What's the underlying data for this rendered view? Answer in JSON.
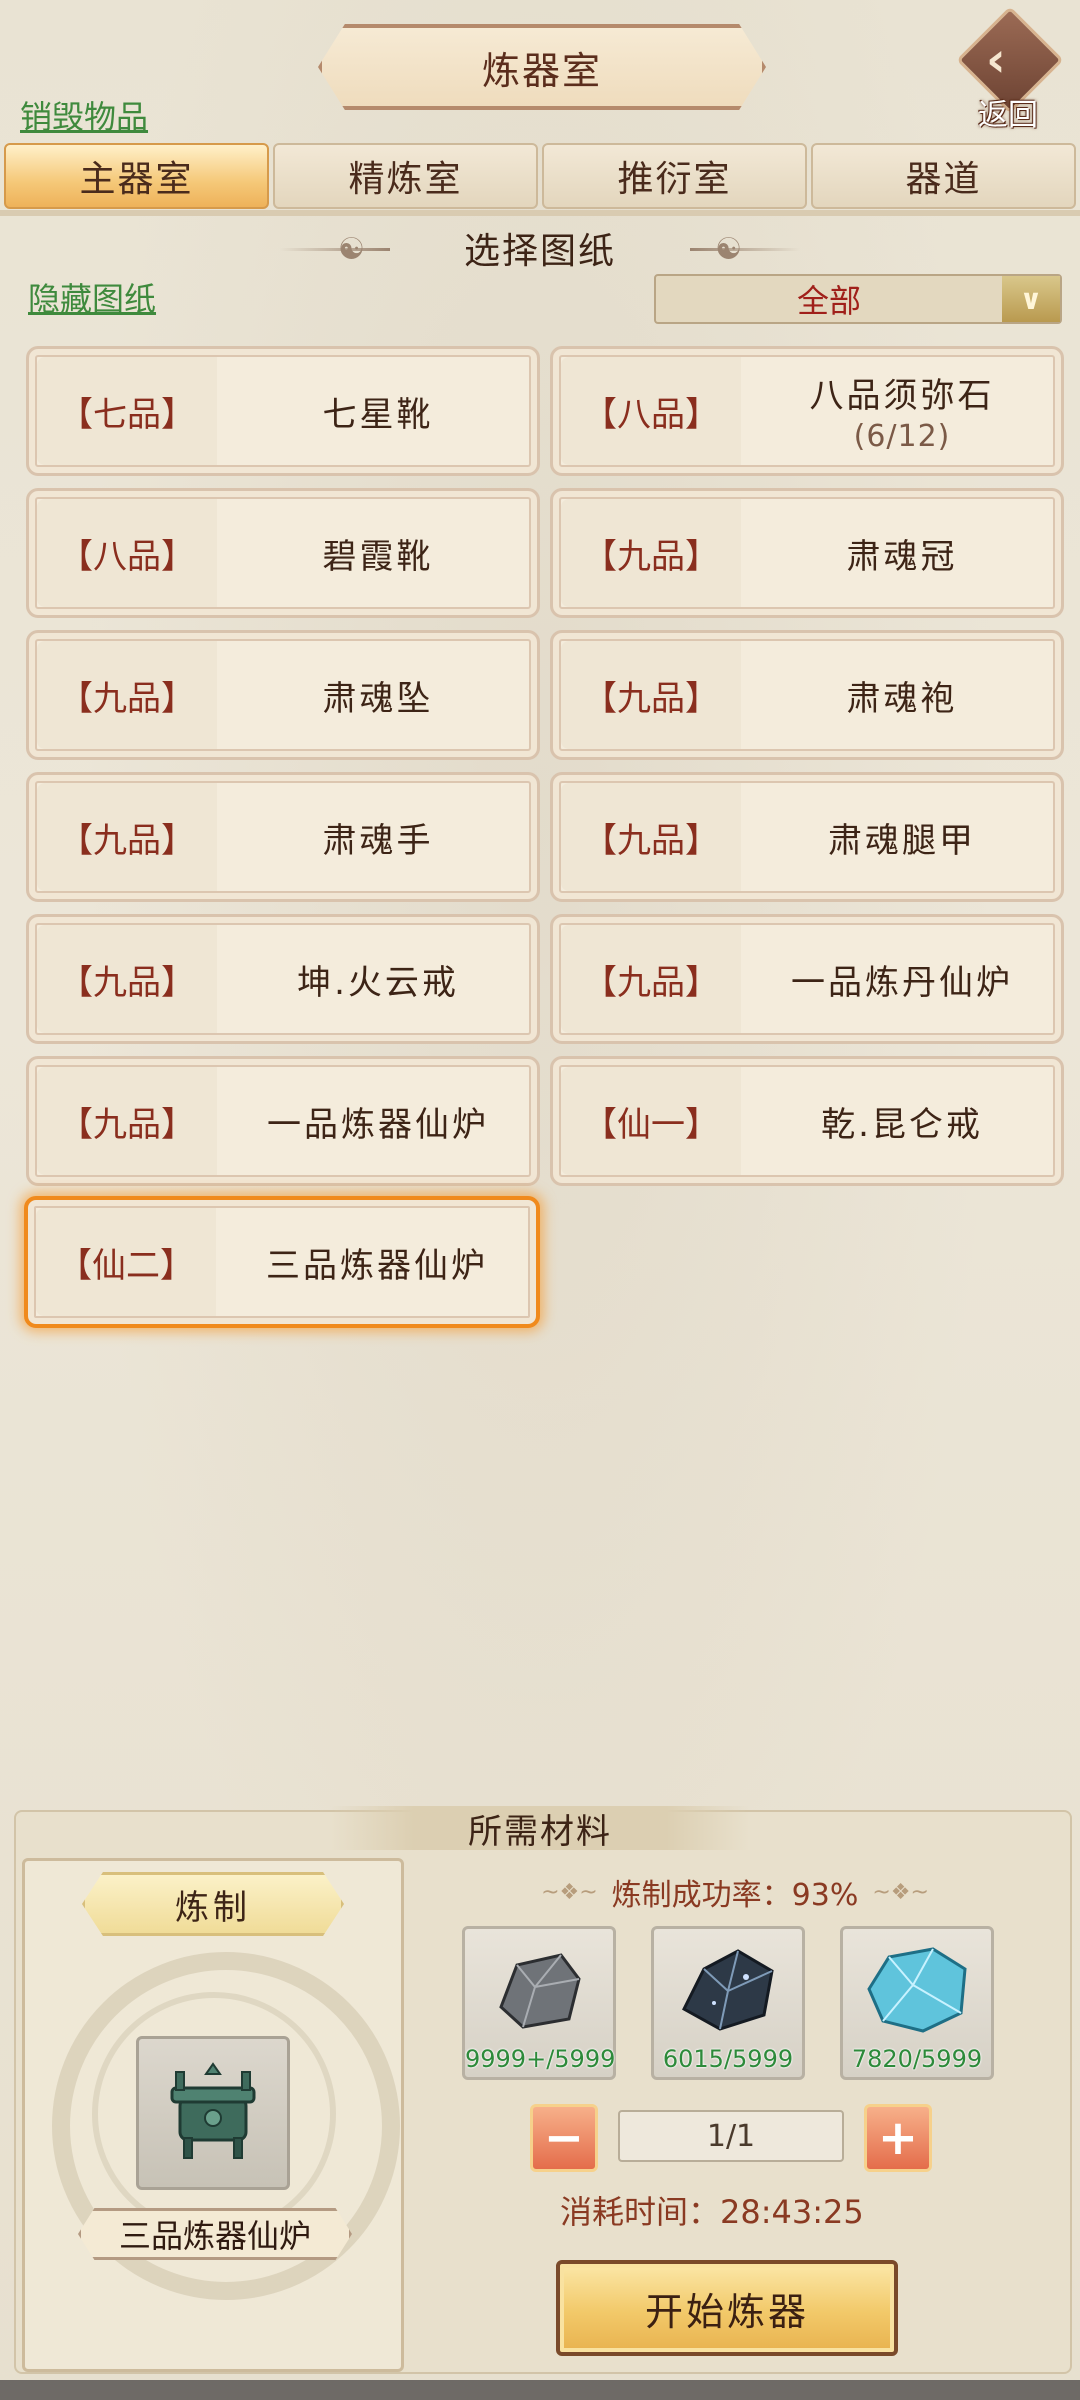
{
  "header": {
    "title": "炼器室",
    "back_label": "返回"
  },
  "links": {
    "destroy_items": "销毁物品",
    "hide_blueprints": "隐藏图纸"
  },
  "tabs": [
    {
      "label": "主器室",
      "active": true
    },
    {
      "label": "精炼室",
      "active": false
    },
    {
      "label": "推衍室",
      "active": false
    },
    {
      "label": "器道",
      "active": false
    }
  ],
  "section": {
    "title": "选择图纸"
  },
  "filter": {
    "selected": "全部"
  },
  "blueprints": [
    {
      "grade": "【七品】",
      "name": "七星靴",
      "sub": ""
    },
    {
      "grade": "【八品】",
      "name": "八品须弥石",
      "sub": "(6/12)"
    },
    {
      "grade": "【八品】",
      "name": "碧霞靴",
      "sub": ""
    },
    {
      "grade": "【九品】",
      "name": "肃魂冠",
      "sub": ""
    },
    {
      "grade": "【九品】",
      "name": "肃魂坠",
      "sub": ""
    },
    {
      "grade": "【九品】",
      "name": "肃魂袍",
      "sub": ""
    },
    {
      "grade": "【九品】",
      "name": "肃魂手",
      "sub": ""
    },
    {
      "grade": "【九品】",
      "name": "肃魂腿甲",
      "sub": ""
    },
    {
      "grade": "【九品】",
      "name": "坤.火云戒",
      "sub": ""
    },
    {
      "grade": "【九品】",
      "name": "一品炼丹仙炉",
      "sub": ""
    },
    {
      "grade": "【九品】",
      "name": "一品炼器仙炉",
      "sub": ""
    },
    {
      "grade": "【仙一】",
      "name": "乾.昆仑戒",
      "sub": ""
    },
    {
      "grade": "【仙二】",
      "name": "三品炼器仙炉",
      "sub": "",
      "selected": true
    }
  ],
  "materials": {
    "title": "所需材料",
    "forge_label": "炼制",
    "product_name": "三品炼器仙炉",
    "success_rate": "炼制成功率：93%",
    "items": [
      {
        "icon": "grey-ore-icon",
        "count": "9999+/5999"
      },
      {
        "icon": "dark-crystal-ore-icon",
        "count": "6015/5999"
      },
      {
        "icon": "blue-crystal-icon",
        "count": "7820/5999"
      }
    ],
    "quantity": "1/1",
    "time": "消耗时间：28:43:25",
    "start_label": "开始炼器"
  },
  "colors": {
    "selected_glow": "#f08a1c",
    "tab_active": "#f5c878",
    "link": "#3f8a3d",
    "count_green": "#2d8a3a"
  }
}
